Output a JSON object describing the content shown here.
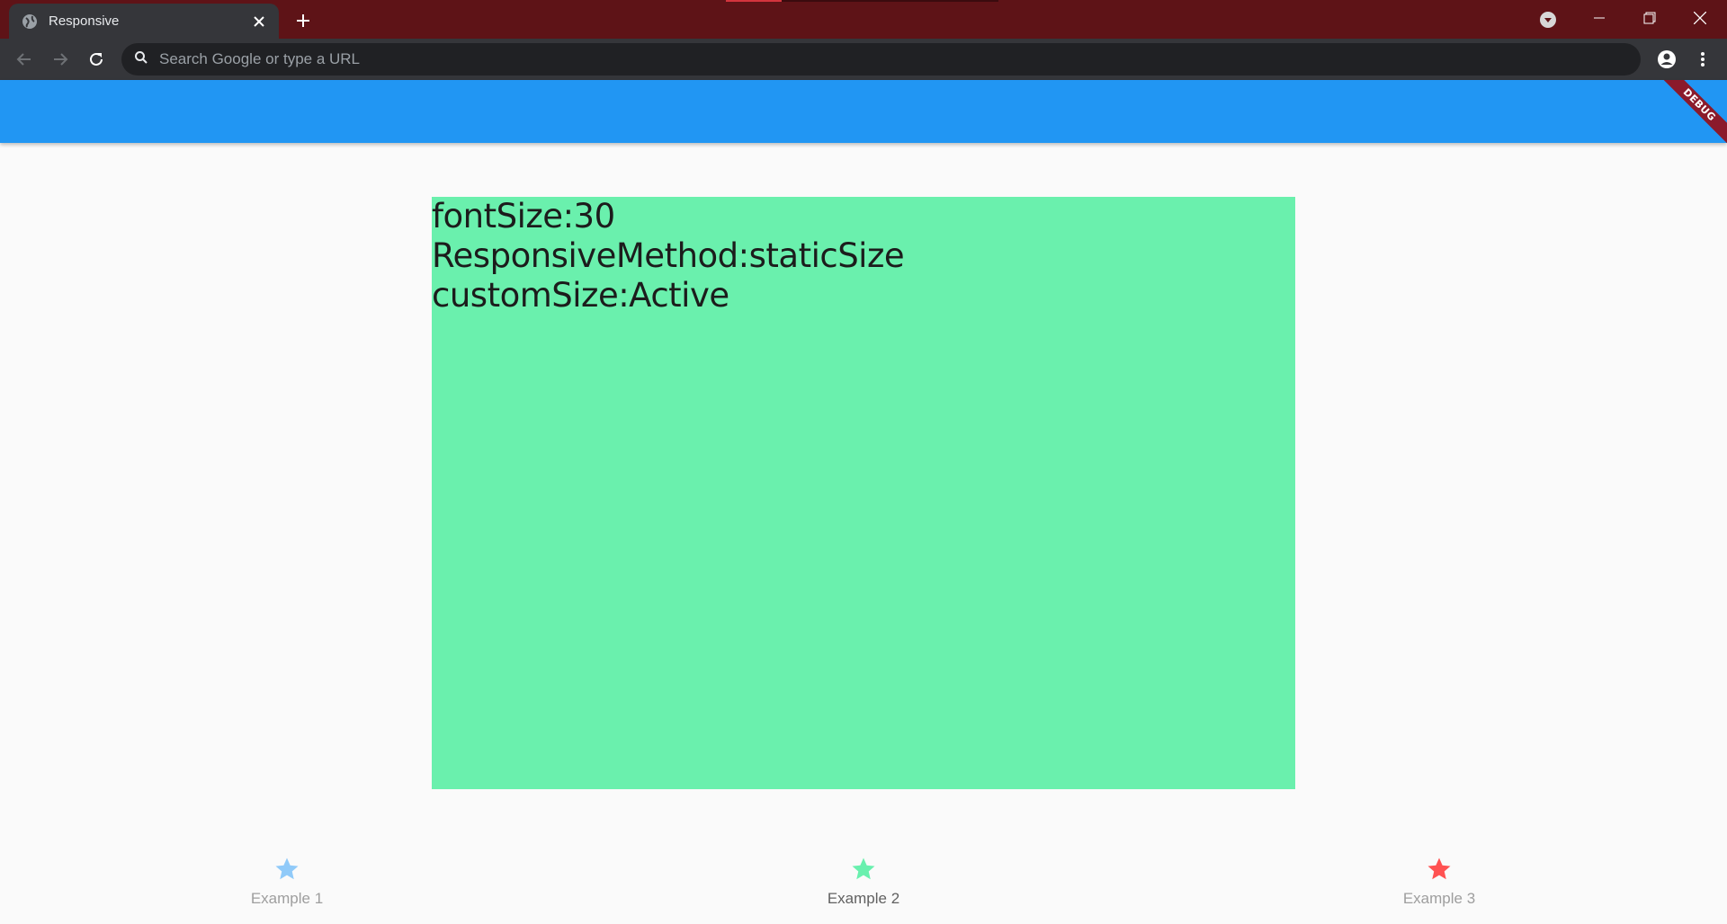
{
  "browser": {
    "tab_title": "Responsive",
    "omnibox_placeholder": "Search Google or type a URL"
  },
  "debug_banner": "DEBUG",
  "content": {
    "lines": [
      "fontSize:30",
      "ResponsiveMethod:staticSize",
      "customSize:Active"
    ],
    "box_color": "#6af0ad"
  },
  "bottom_nav": {
    "items": [
      {
        "label": "Example 1",
        "color": "#90caf9",
        "icon": "star-icon"
      },
      {
        "label": "Example 2",
        "color": "#69f0ae",
        "icon": "star-icon"
      },
      {
        "label": "Example 3",
        "color": "#ff5252",
        "icon": "star-icon"
      }
    ],
    "selected": "Example 2"
  },
  "colors": {
    "titlebar": "#5e1317",
    "appbar": "#2196f3"
  }
}
